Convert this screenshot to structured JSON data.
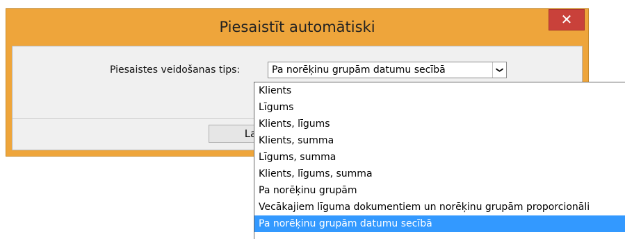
{
  "dialog": {
    "title": "Piesaistīt automātiski",
    "close_glyph": "✕",
    "label": "Piesaistes veidošanas tips:",
    "selected_value": "Pa norēķinu grupām datumu secībā",
    "arrow_glyph": "❯",
    "ok_label": "Labi"
  },
  "dropdown": {
    "options": [
      "Klients",
      "Līgums",
      "Klients, līgums",
      "Klients, summa",
      "Līgums, summa",
      "Klients, līgums, summa",
      "Pa norēķinu grupām",
      "Vecākajiem līguma dokumentiem un norēķinu grupām proporcionāli",
      "Pa norēķinu grupām datumu secībā"
    ],
    "selected_index": 8
  }
}
